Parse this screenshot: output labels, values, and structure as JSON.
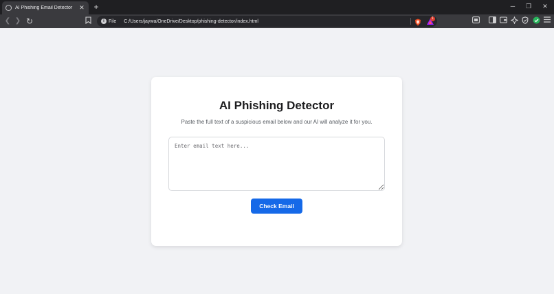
{
  "tab": {
    "title": "AI Phishing Email Detector",
    "close_glyph": "✕",
    "new_tab_glyph": "+"
  },
  "window_controls": {
    "minimize": "─",
    "restore": "❐",
    "close": "✕"
  },
  "toolbar": {
    "back_glyph": "❮",
    "forward_glyph": "❯",
    "reload_glyph": "↻",
    "bookmark_glyph": "☐",
    "info_glyph": "i",
    "scheme_label": "File",
    "url": "C:/Users/jaywa/OneDrive/Desktop/phishing-detector/index.html",
    "rewards_badge": "1"
  },
  "page": {
    "title": "AI Phishing Detector",
    "subtitle": "Paste the full text of a suspicious email below and our AI will analyze it for you.",
    "email_input": {
      "value": "",
      "placeholder": "Enter email text here..."
    },
    "check_button_label": "Check Email"
  },
  "colors": {
    "accent": "#1569e8",
    "page_background": "#f1f2f5",
    "brave_shield": "#f04e23",
    "rewards_badge": "#e0402f"
  }
}
